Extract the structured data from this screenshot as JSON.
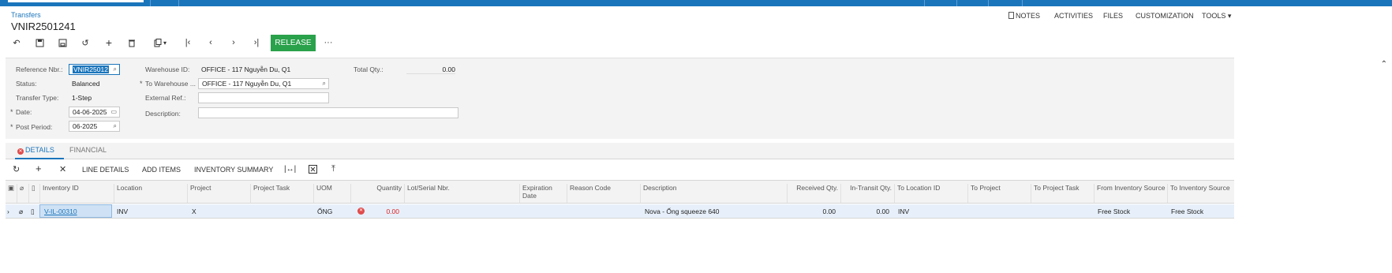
{
  "breadcrumb": "Transfers",
  "title": "VNIR2501241",
  "top_links": [
    "NOTES",
    "ACTIVITIES",
    "FILES",
    "CUSTOMIZATION",
    "TOOLS"
  ],
  "toolbar": {
    "release_label": "RELEASE",
    "icons": [
      "undo-icon",
      "save-close-icon",
      "save-icon",
      "cancel-icon",
      "add-icon",
      "delete-icon",
      "copy-paste-icon",
      "first-icon",
      "prev-icon",
      "next-icon",
      "last-icon",
      "more-icon"
    ]
  },
  "form": {
    "reference_nbr_label": "Reference Nbr.:",
    "reference_nbr_value": "VNIR25012",
    "status_label": "Status:",
    "status_value": "Balanced",
    "transfer_type_label": "Transfer Type:",
    "transfer_type_value": "1-Step",
    "date_label": "Date:",
    "date_value": "04-06-2025",
    "post_period_label": "Post Period:",
    "post_period_value": "06-2025",
    "warehouse_id_label": "Warehouse ID:",
    "warehouse_id_value": "OFFICE - 117 Nguyễn Du, Q1",
    "to_warehouse_label": "To Warehouse ...",
    "to_warehouse_value": "OFFICE - 117 Nguyễn Du, Q1",
    "external_ref_label": "External Ref.:",
    "external_ref_value": "",
    "description_label": "Description:",
    "description_value": "",
    "total_qty_label": "Total Qty.:",
    "total_qty_value": "0.00"
  },
  "tabs": [
    {
      "label": "DETAILS",
      "active": true
    },
    {
      "label": "FINANCIAL",
      "active": false
    }
  ],
  "grid_toolbar": {
    "line_details": "LINE DETAILS",
    "add_items": "ADD ITEMS",
    "inventory_summary": "INVENTORY SUMMARY"
  },
  "grid": {
    "columns": [
      "Inventory ID",
      "Location",
      "Project",
      "Project Task",
      "UOM",
      "Quantity",
      "Lot/Serial Nbr.",
      "Expiration Date",
      "Reason Code",
      "Description",
      "Received Qty.",
      "In-Transit Qty.",
      "To Location ID",
      "To Project",
      "To Project Task",
      "From Inventory Source",
      "To Inventory Source"
    ],
    "rows": [
      {
        "inventory_id": "V-IL-00310",
        "location": "INV",
        "project": "X",
        "project_task": "",
        "uom": "ỐNG",
        "quantity": "0.00",
        "lot_serial": "",
        "expiration_date": "",
        "reason_code": "",
        "description": "Nova - Ống squeeze 640",
        "received_qty": "0.00",
        "in_transit_qty": "0.00",
        "to_location": "INV",
        "to_project": "",
        "to_project_task": "",
        "from_inventory_source": "Free Stock",
        "to_inventory_source": "Free Stock"
      }
    ]
  },
  "colors": {
    "accent": "#1b75bb",
    "release": "#2aa14b",
    "error": "#e04b4b"
  }
}
